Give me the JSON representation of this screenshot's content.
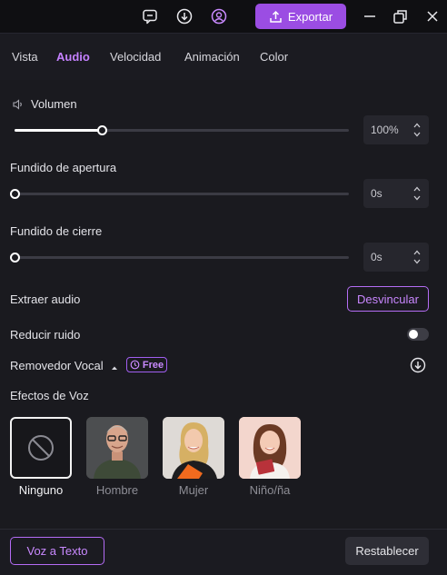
{
  "titlebar": {
    "export_label": "Exportar",
    "icons": [
      "feedback-icon",
      "download-icon",
      "account-icon",
      "minimize-icon",
      "restore-icon",
      "close-icon"
    ]
  },
  "tabs": [
    {
      "label": "Vista",
      "active": false
    },
    {
      "label": "Audio",
      "active": true
    },
    {
      "label": "Velocidad",
      "active": false
    },
    {
      "label": "Animación",
      "active": false
    },
    {
      "label": "Color",
      "active": false
    }
  ],
  "audio": {
    "volume": {
      "label": "Volumen",
      "value": "100%",
      "level": 0.26
    },
    "fade_in": {
      "label": "Fundido de apertura",
      "value": "0s",
      "level": 0
    },
    "fade_out": {
      "label": "Fundido de cierre",
      "value": "0s",
      "level": 0
    },
    "extract": {
      "label": "Extraer audio",
      "button": "Desvincular"
    },
    "denoise": {
      "label": "Reducir ruido",
      "enabled": false
    },
    "vocal_remover": {
      "label": "Removedor Vocal",
      "badge": "Free"
    },
    "voice_effects": {
      "label": "Efectos de Voz",
      "items": [
        {
          "label": "Ninguno",
          "selected": true
        },
        {
          "label": "Hombre",
          "selected": false
        },
        {
          "label": "Mujer",
          "selected": false
        },
        {
          "label": "Niño/ña",
          "selected": false
        }
      ]
    }
  },
  "footer": {
    "tts_label": "Voz a Texto",
    "reset_label": "Restablecer"
  },
  "colors": {
    "accent": "#9b4de3",
    "accent_text": "#c581ff",
    "background": "#1a1a1f"
  }
}
